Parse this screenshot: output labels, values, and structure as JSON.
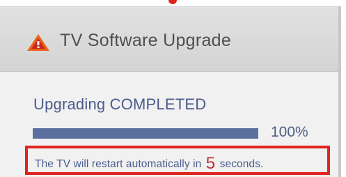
{
  "colors": {
    "dialog_bg": "#f1f1f1",
    "header_bg": "#dcdcdc",
    "title_text": "#4f4f4f",
    "status_text": "#4b5c8c",
    "progress_fill": "#5a6f9d",
    "progress_track": "#c9cfdc",
    "highlight_border": "#e0241f",
    "countdown_number": "#b8323d",
    "warning_icon": "#e8661c"
  },
  "dialog": {
    "icon": "warning-icon",
    "title": "TV Software Upgrade"
  },
  "upgrade": {
    "status": "Upgrading COMPLETED",
    "progress_percent": 100,
    "progress_label": "100%"
  },
  "restart": {
    "message_prefix": "The TV will restart automatically in",
    "countdown": "5",
    "message_suffix": "seconds."
  }
}
